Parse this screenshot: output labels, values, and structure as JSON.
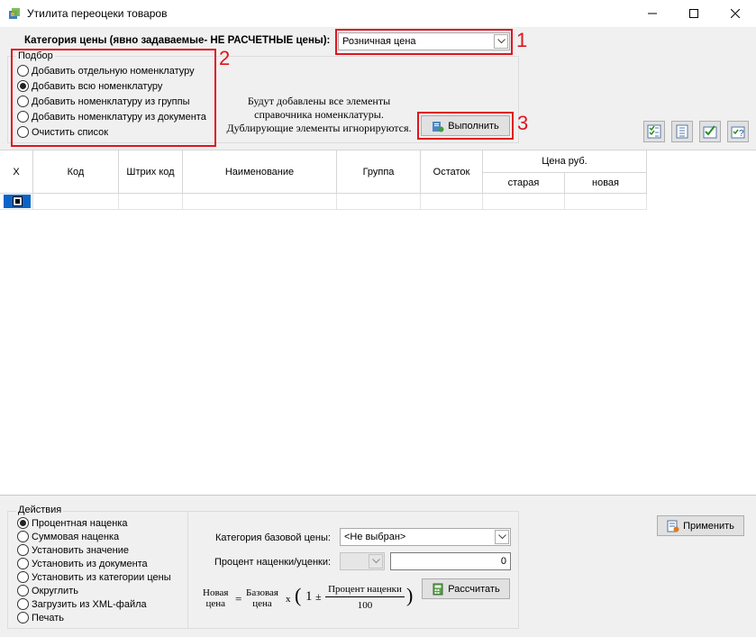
{
  "window": {
    "title": "Утилита переоцеки товаров"
  },
  "price_category": {
    "label": "Категория цены (явно задаваемые- НЕ РАСЧЕТНЫЕ цены):",
    "value": "Розничная цена"
  },
  "annotations": {
    "n1": "1",
    "n2": "2",
    "n3": "3",
    "color": "#e0141e"
  },
  "selection": {
    "legend": "Подбор",
    "options": [
      "Добавить отдельную номенклатуру",
      "Добавить всю номенклатуру",
      "Добавить номенклатуру из группы",
      "Добавить номенклатуру из документа",
      "Очистить список"
    ],
    "selected_index": 1,
    "info_lines": [
      "Будут добавлены все элементы",
      "справочника номенклатуры.",
      "Дублирующие элементы игнорируются."
    ],
    "execute_label": "Выполнить"
  },
  "toolbar": {
    "icons": [
      "check-all-icon",
      "uncheck-all-icon",
      "check-icon",
      "help-check-icon"
    ]
  },
  "table": {
    "columns": {
      "x": "X",
      "code": "Код",
      "barcode": "Штрих код",
      "name": "Наименование",
      "group": "Группа",
      "stock": "Остаток",
      "price": "Цена руб.",
      "old": "старая",
      "new": "новая"
    }
  },
  "actions": {
    "legend": "Действия",
    "options": [
      "Процентная наценка",
      "Суммовая наценка",
      "Установить значение",
      "Установить из документа",
      "Установить из категории цены",
      "Округлить",
      "Загрузить из XML-файла",
      "Печать"
    ],
    "selected_index": 0,
    "base_price_label": "Категория базовой цены:",
    "base_price_value": "<Не выбран>",
    "percent_label": "Процент наценки/уценки:",
    "percent_value": "0",
    "calculate_label": "Рассчитать",
    "apply_label": "Применить",
    "formula": {
      "new_top": "Новая",
      "new_bottom": "цена",
      "eq": "=",
      "base_top": "Базовая",
      "base_bottom": "цена",
      "x": "x",
      "open": "(",
      "one": "1",
      "pm": "±",
      "numerator": "Процент наценки",
      "denominator": "100",
      "close": ")"
    }
  }
}
